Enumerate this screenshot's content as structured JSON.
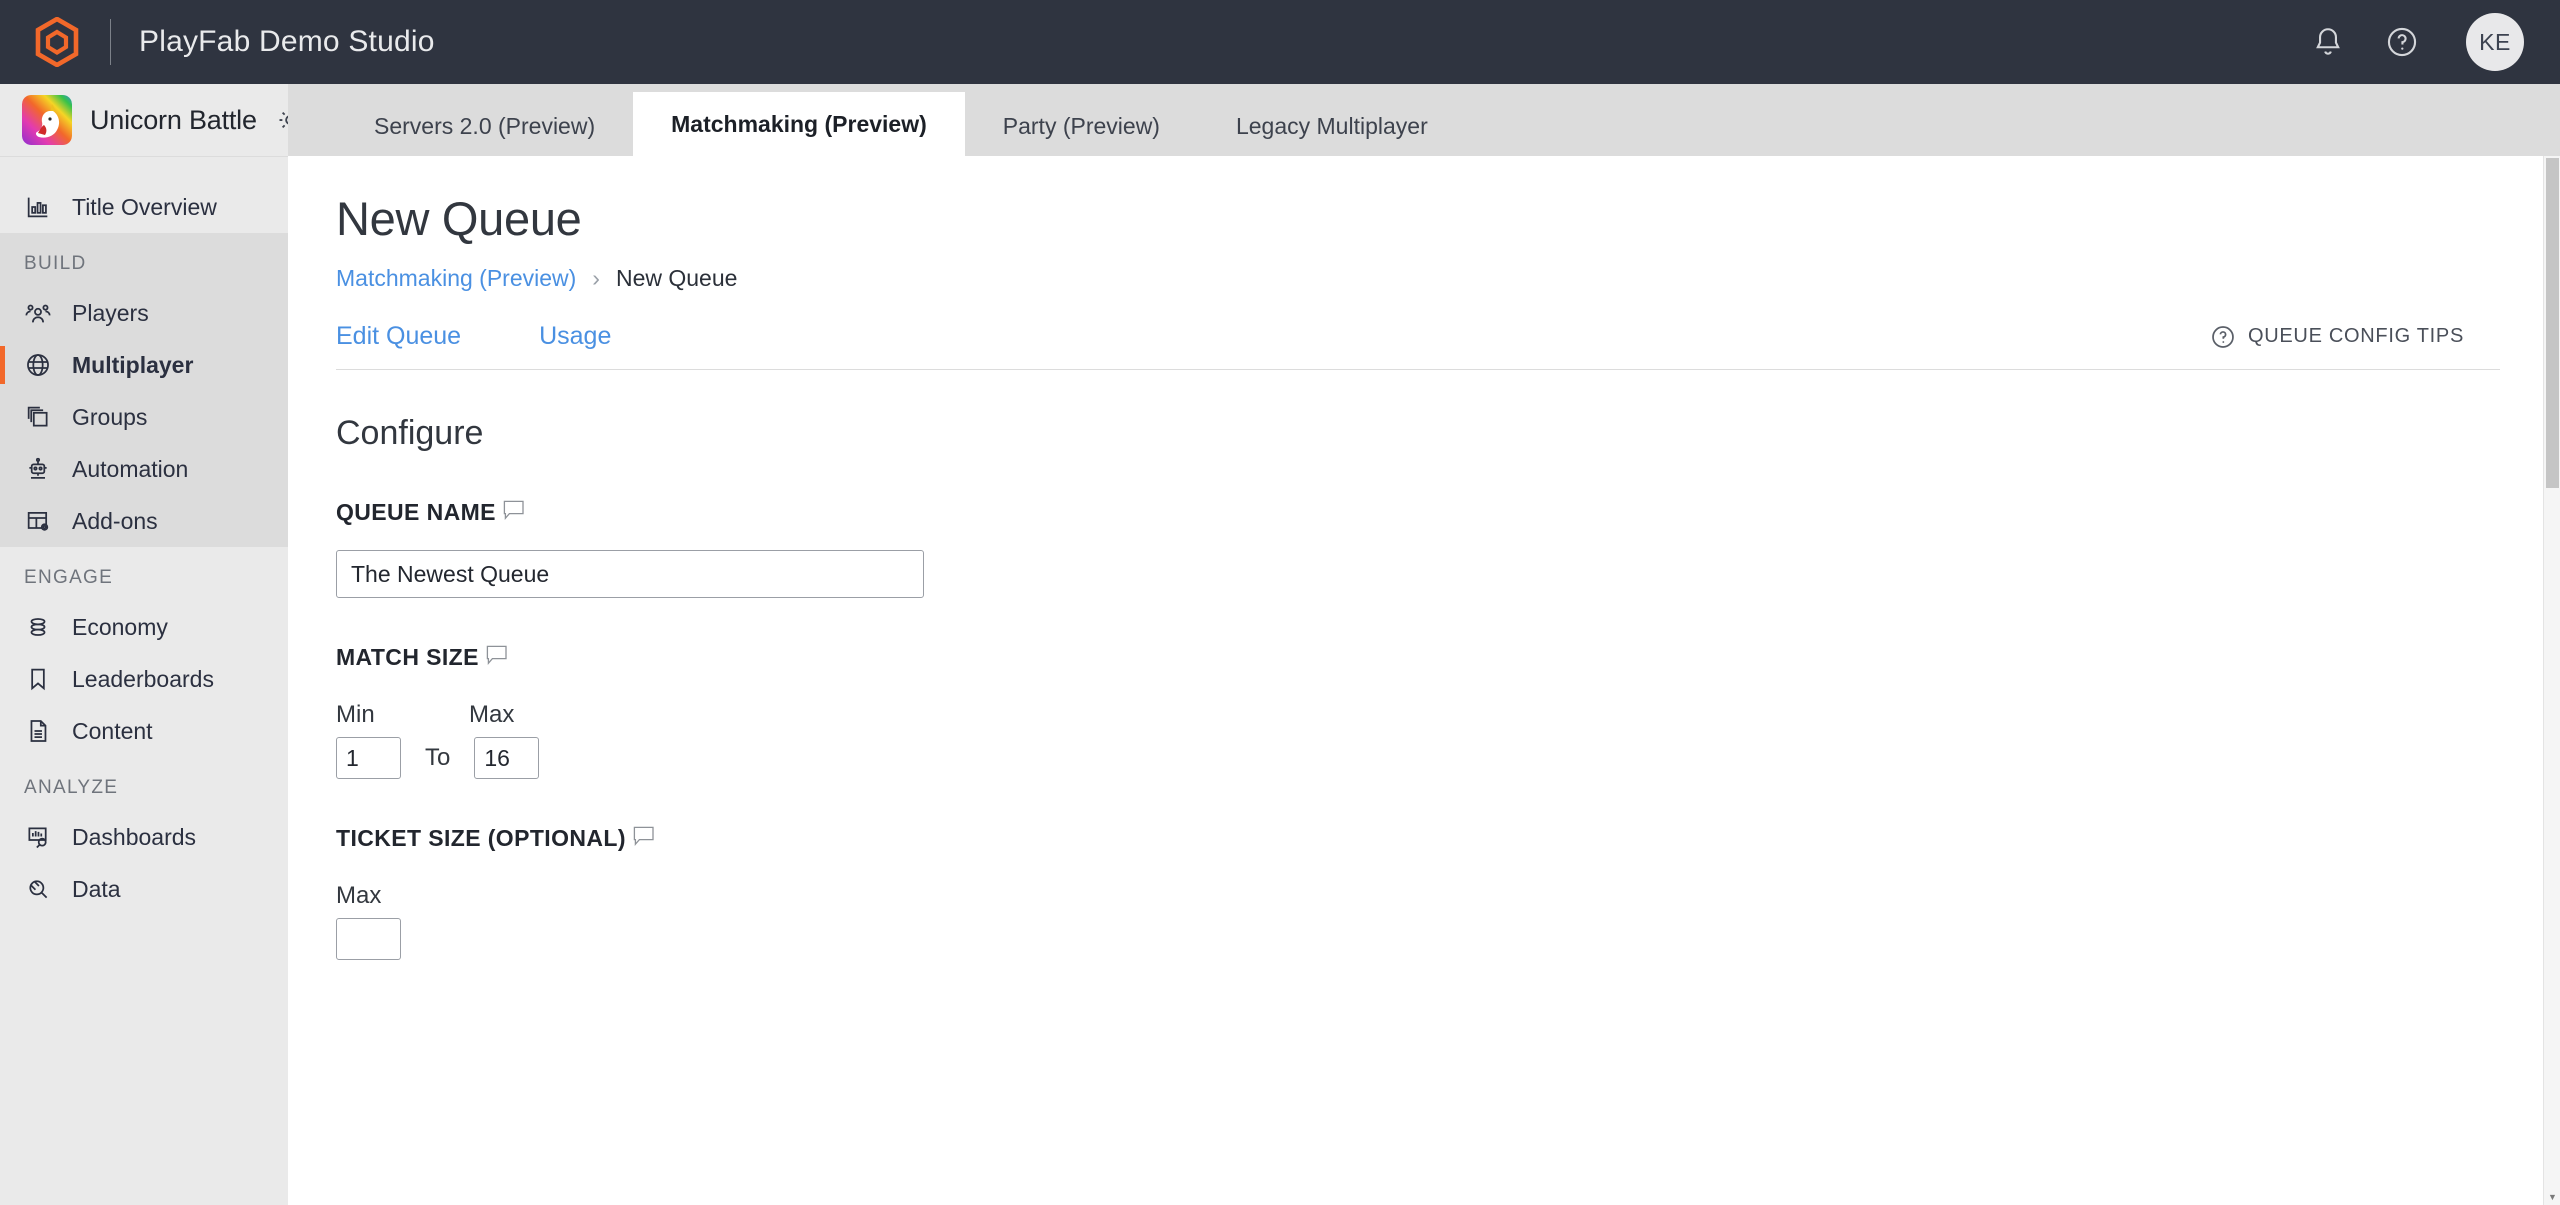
{
  "header": {
    "studio_title": "PlayFab Demo Studio",
    "logo_icon": "playfab-hexagon-logo",
    "notification_icon": "bell-icon",
    "help_icon": "question-circle-icon",
    "avatar_initials": "KE",
    "brand_orange": "#f2682a",
    "bar_color": "#2f3440"
  },
  "sidebar": {
    "game_title": "Unicorn Battle",
    "game_icon": "unicorn-game-icon",
    "settings_icon": "gear-icon",
    "overview": {
      "label": "Title Overview",
      "icon": "bar-chart-icon"
    },
    "sections": [
      {
        "label": "BUILD",
        "items": [
          {
            "label": "Players",
            "icon": "people-icon",
            "active": false
          },
          {
            "label": "Multiplayer",
            "icon": "globe-icon",
            "active": true
          },
          {
            "label": "Groups",
            "icon": "stacked-squares-icon",
            "active": false
          },
          {
            "label": "Automation",
            "icon": "robot-icon",
            "active": false
          },
          {
            "label": "Add-ons",
            "icon": "table-gear-icon",
            "active": false
          }
        ]
      },
      {
        "label": "ENGAGE",
        "items": [
          {
            "label": "Economy",
            "icon": "coin-stack-icon",
            "active": false
          },
          {
            "label": "Leaderboards",
            "icon": "bookmark-icon",
            "active": false
          },
          {
            "label": "Content",
            "icon": "document-icon",
            "active": false
          }
        ]
      },
      {
        "label": "ANALYZE",
        "items": [
          {
            "label": "Dashboards",
            "icon": "chart-search-icon",
            "active": false
          },
          {
            "label": "Data",
            "icon": "plug-icon",
            "active": false
          }
        ]
      }
    ]
  },
  "tabs": [
    {
      "label": "Servers 2.0 (Preview)",
      "active": false
    },
    {
      "label": "Matchmaking (Preview)",
      "active": true
    },
    {
      "label": "Party (Preview)",
      "active": false
    },
    {
      "label": "Legacy Multiplayer",
      "active": false
    }
  ],
  "page": {
    "title": "New Queue",
    "breadcrumb": {
      "parent": "Matchmaking (Preview)",
      "separator": "›",
      "current": "New Queue"
    },
    "subtabs": [
      {
        "label": "Edit Queue"
      },
      {
        "label": "Usage"
      }
    ],
    "tips": {
      "label": "QUEUE CONFIG TIPS",
      "icon": "question-circle-icon"
    }
  },
  "form": {
    "section_title": "Configure",
    "queue_name": {
      "label": "QUEUE NAME",
      "tooltip_icon": "speech-bubble-icon",
      "value": "The Newest Queue",
      "placeholder": ""
    },
    "match_size": {
      "label": "MATCH SIZE",
      "tooltip_icon": "speech-bubble-icon",
      "min_label": "Min",
      "max_label": "Max",
      "to_label": "To",
      "min_value": "1",
      "max_value": "16"
    },
    "ticket_size": {
      "label": "TICKET SIZE (OPTIONAL)",
      "tooltip_icon": "speech-bubble-icon",
      "max_label": "Max"
    }
  }
}
